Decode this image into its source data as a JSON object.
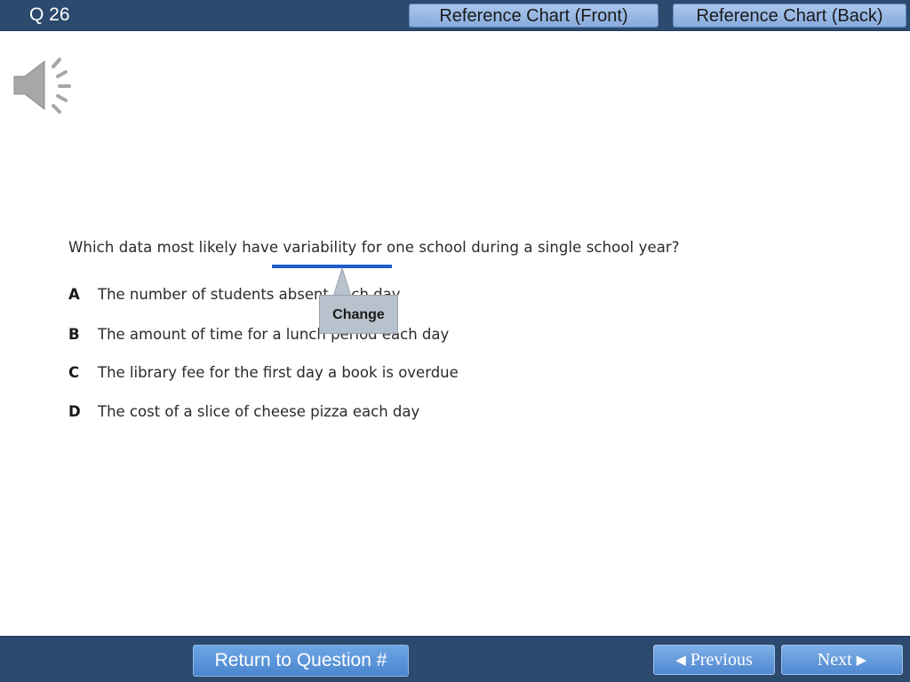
{
  "header": {
    "question_number": "Q 26",
    "ref_front_label": "Reference Chart (Front)",
    "ref_back_label": "Reference Chart (Back)"
  },
  "audio": {
    "icon": "speaker-icon"
  },
  "question": {
    "text": "Which data most likely have variability for one school during a single school year?",
    "underlined_phrase": "have variability"
  },
  "choices": [
    {
      "letter": "A",
      "text": "The number of students absent each day"
    },
    {
      "letter": "B",
      "text": "The amount of time for a lunch period each day"
    },
    {
      "letter": "C",
      "text": "The library fee for the first day a book is overdue"
    },
    {
      "letter": "D",
      "text": "The cost of a slice of cheese pizza each day"
    }
  ],
  "callout": {
    "label": "Change"
  },
  "footer": {
    "return_label": "Return to Question #",
    "previous_label": "Previous",
    "next_label": "Next",
    "previous_icon": "triangle-left-icon",
    "next_icon": "triangle-right-icon"
  },
  "colors": {
    "bar": "#2c4a6e",
    "ref_button": "#a9c6ec",
    "nav_button": "#4e88cf",
    "underline": "#1f5ccc",
    "callout": "#b8c2cc"
  }
}
